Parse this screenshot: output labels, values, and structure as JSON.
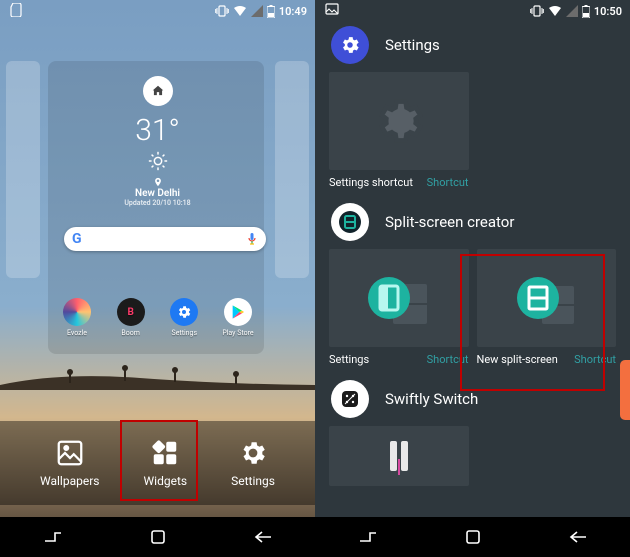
{
  "status": {
    "left": {
      "time": "10:49"
    },
    "right": {
      "time": "10:50"
    }
  },
  "weather": {
    "temperature": "31°",
    "city": "New Delhi",
    "updated": "Updated 20/10 10:18"
  },
  "apps": [
    {
      "label": "Evozle"
    },
    {
      "label": "Boom"
    },
    {
      "label": "Settings"
    },
    {
      "label": "Play Store"
    }
  ],
  "launcher_options": {
    "wallpapers": "Wallpapers",
    "widgets": "Widgets",
    "settings": "Settings"
  },
  "widget_picker": {
    "groups": [
      {
        "title": "Settings",
        "tiles": [
          {
            "name": "Settings shortcut",
            "tag": "Shortcut"
          }
        ]
      },
      {
        "title": "Split-screen creator",
        "tiles": [
          {
            "name": "Settings",
            "tag": "Shortcut"
          },
          {
            "name": "New split-screen",
            "tag": "Shortcut"
          }
        ]
      },
      {
        "title": "Swiftly Switch",
        "tiles": []
      }
    ]
  },
  "colors": {
    "highlight": "#c00000",
    "shortcut_tag": "#31a0a4",
    "edge_handle": "#f36f3f"
  }
}
